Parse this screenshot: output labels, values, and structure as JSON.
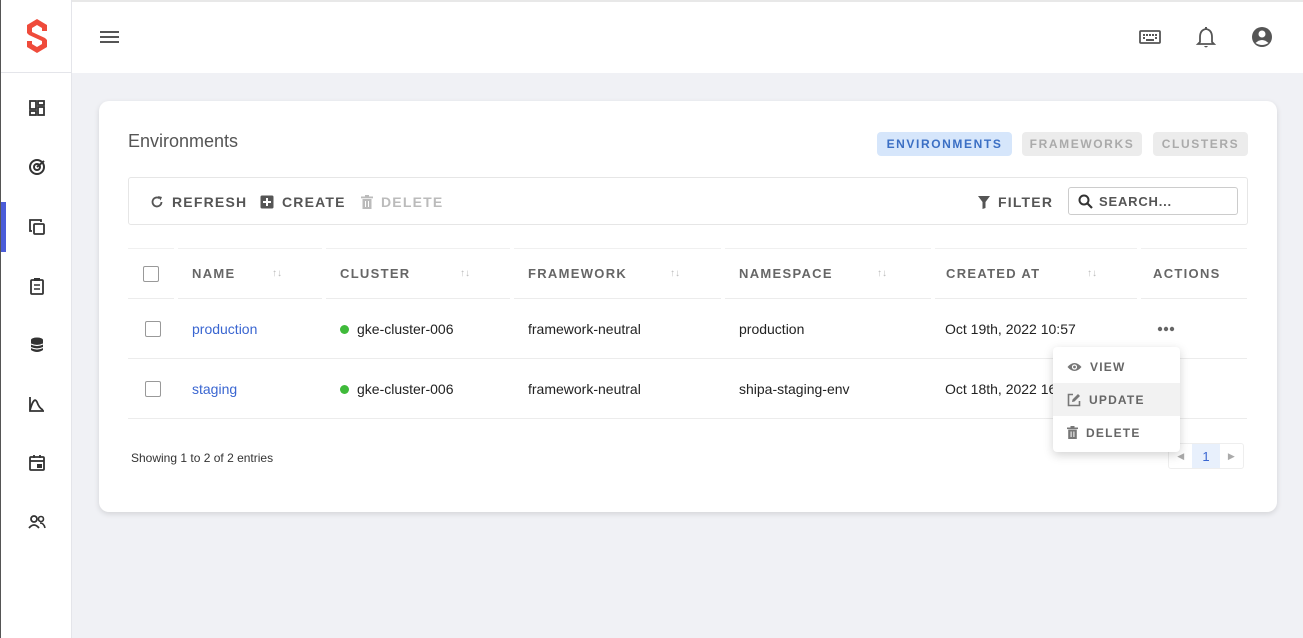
{
  "header": {
    "icons": [
      "menu-icon",
      "keyboard-icon",
      "bell-icon",
      "account-circle-icon"
    ]
  },
  "sidebar": {
    "items": [
      {
        "icon": "dashboard-icon"
      },
      {
        "icon": "target-icon"
      },
      {
        "icon": "layers-icon",
        "active": true
      },
      {
        "icon": "clipboard-icon"
      },
      {
        "icon": "database-icon"
      },
      {
        "icon": "chart-icon"
      },
      {
        "icon": "calendar-icon"
      },
      {
        "icon": "people-icon"
      }
    ]
  },
  "card": {
    "title": "Environments",
    "tabs": [
      {
        "label": "ENVIRONMENTS",
        "active": true
      },
      {
        "label": "FRAMEWORKS",
        "active": false
      },
      {
        "label": "CLUSTERS",
        "active": false
      }
    ]
  },
  "toolbar": {
    "refresh": "REFRESH",
    "create": "CREATE",
    "delete": "DELETE",
    "filter": "FILTER",
    "search_placeholder": "SEARCH..."
  },
  "table": {
    "columns": [
      "NAME",
      "CLUSTER",
      "FRAMEWORK",
      "NAMESPACE",
      "CREATED AT",
      "ACTIONS"
    ],
    "rows": [
      {
        "name": "production",
        "cluster": "gke-cluster-006",
        "framework": "framework-neutral",
        "namespace": "production",
        "created_at": "Oct 19th, 2022 10:57"
      },
      {
        "name": "staging",
        "cluster": "gke-cluster-006",
        "framework": "framework-neutral",
        "namespace": "shipa-staging-env",
        "created_at": "Oct 18th, 2022 16"
      }
    ],
    "footer": "Showing 1 to 2 of 2 entries",
    "current_page": "1"
  },
  "actions_menu": {
    "items": [
      "VIEW",
      "UPDATE",
      "DELETE"
    ]
  },
  "colors": {
    "accent": "#4a5cd8",
    "link": "#3a66d1",
    "logo": "#ef4b3b",
    "status_green": "#3fba3a"
  }
}
